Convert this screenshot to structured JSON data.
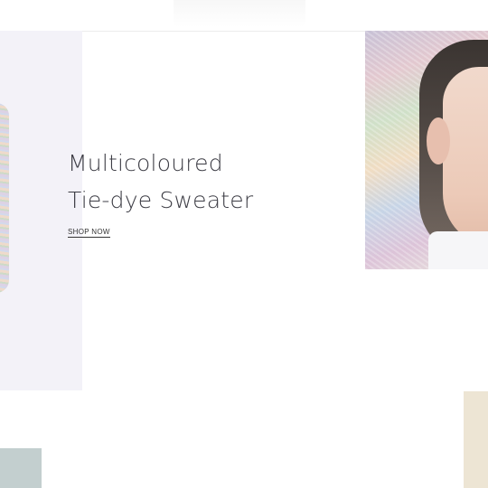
{
  "hero": {
    "title_line1": "Multicoloured",
    "title_line2": "Tie-dye Sweater",
    "cta_label": "SHOP NOW"
  },
  "colors": {
    "left_panel_bg": "#f3f2f8",
    "bottom_left_block": "#c3cfcf",
    "bottom_right_block": "#ede5d4",
    "text": "#3d3d45"
  }
}
